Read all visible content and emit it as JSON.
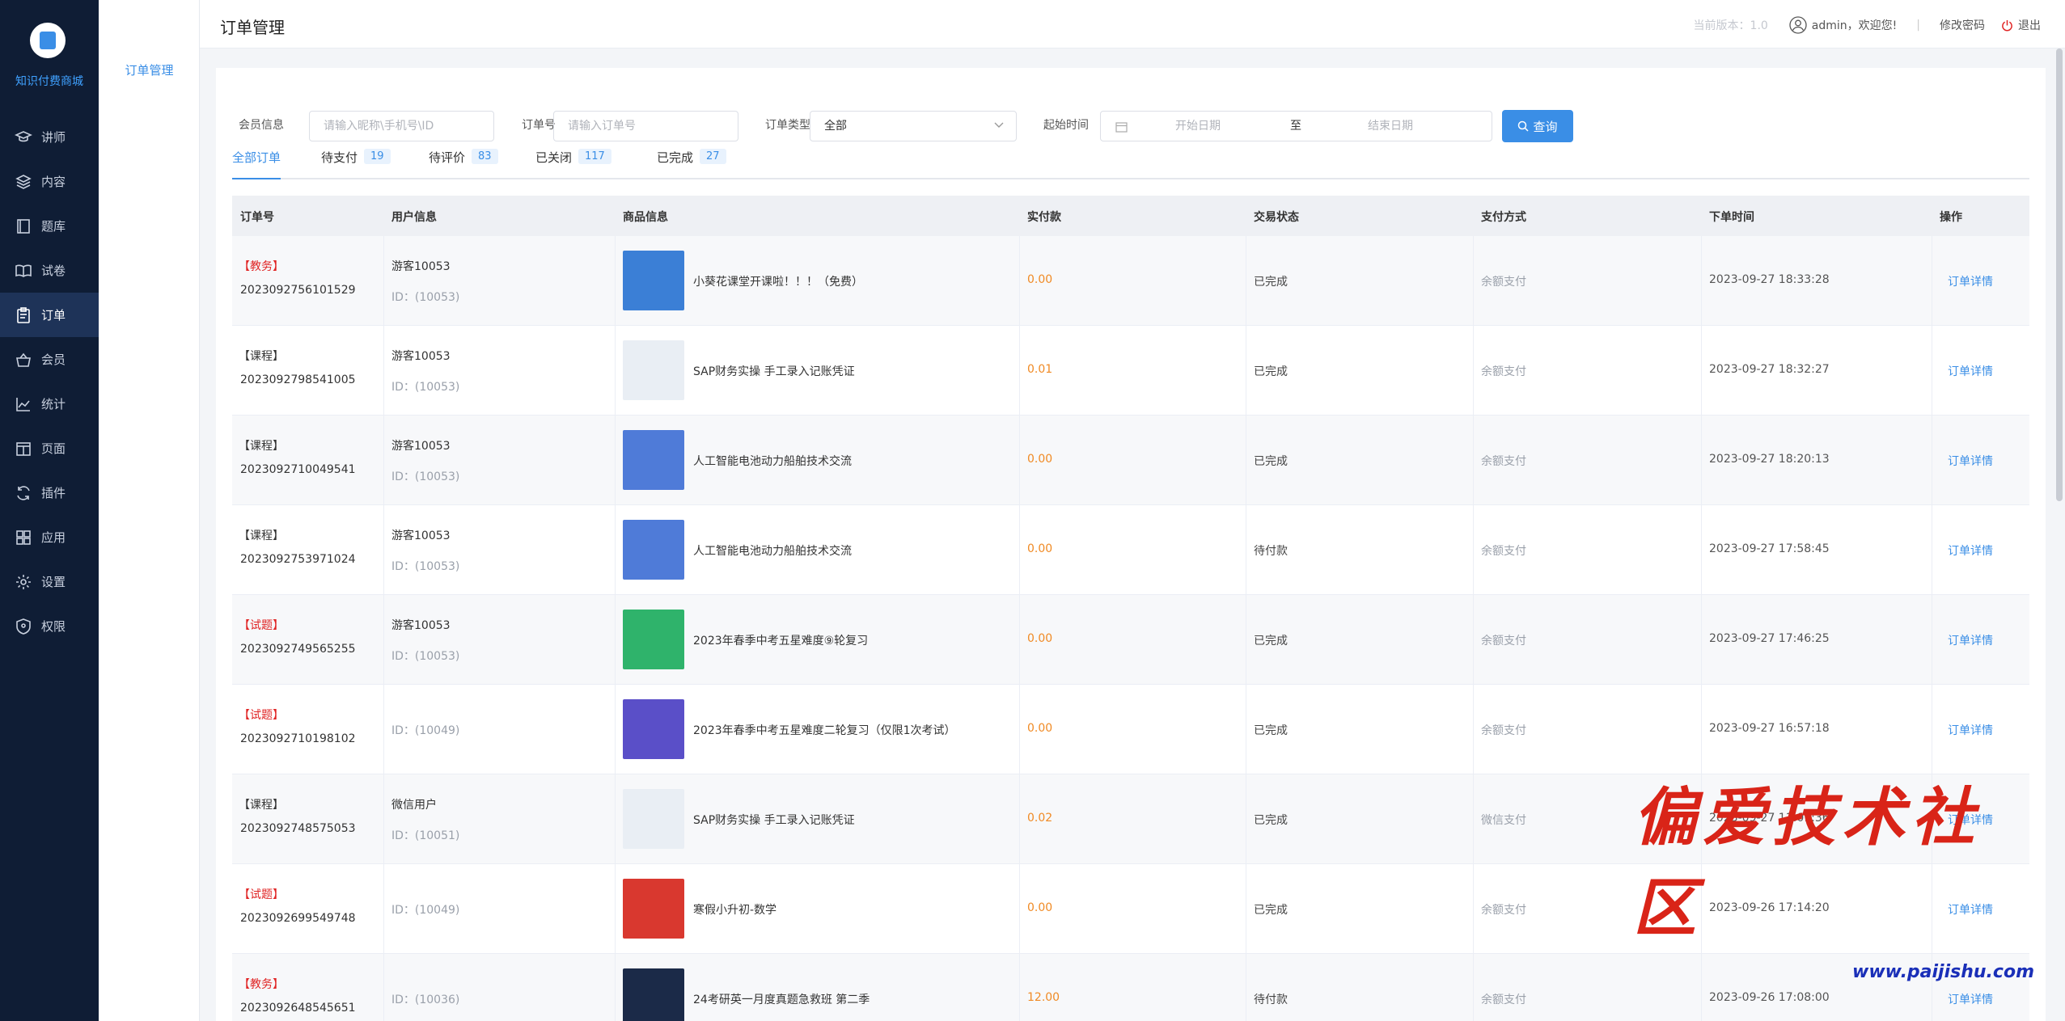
{
  "app": {
    "logo_text": "知识付费商城"
  },
  "sidebar": {
    "items": [
      {
        "label": "讲师",
        "icon": "graduation-cap-icon"
      },
      {
        "label": "内容",
        "icon": "layers-icon"
      },
      {
        "label": "题库",
        "icon": "book-icon"
      },
      {
        "label": "试卷",
        "icon": "open-book-icon"
      },
      {
        "label": "订单",
        "icon": "clipboard-icon",
        "active": true
      },
      {
        "label": "会员",
        "icon": "basket-icon"
      },
      {
        "label": "统计",
        "icon": "line-chart-icon"
      },
      {
        "label": "页面",
        "icon": "page-icon"
      },
      {
        "label": "插件",
        "icon": "refresh-icon"
      },
      {
        "label": "应用",
        "icon": "apps-icon"
      },
      {
        "label": "设置",
        "icon": "gear-icon"
      },
      {
        "label": "权限",
        "icon": "shield-icon"
      }
    ]
  },
  "submenu": {
    "item": "订单管理"
  },
  "header": {
    "title": "订单管理",
    "version": "当前版本：1.0",
    "welcome": "admin，欢迎您!",
    "separator": "|",
    "change_password": "修改密码",
    "logout": "退出"
  },
  "filters": {
    "member_label": "会员信息",
    "member_placeholder": "请输入昵称\\手机号\\ID",
    "order_no_label": "订单号",
    "order_no_placeholder": "请输入订单号",
    "order_type_label": "订单类型",
    "order_type_value": "全部",
    "time_label": "起始时间",
    "start_placeholder": "开始日期",
    "to_label": "至",
    "end_placeholder": "结束日期",
    "query_button": "查询"
  },
  "tabs": [
    {
      "label": "全部订单",
      "count": ""
    },
    {
      "label": "待支付",
      "count": "19"
    },
    {
      "label": "待评价",
      "count": "83"
    },
    {
      "label": "已关闭",
      "count": "117"
    },
    {
      "label": "已完成",
      "count": "27"
    }
  ],
  "table": {
    "headers": [
      "订单号",
      "用户信息",
      "商品信息",
      "实付款",
      "交易状态",
      "支付方式",
      "下单时间",
      "操作"
    ],
    "rows": [
      {
        "tag": "【教务】",
        "tag_red": true,
        "order_no": "2023092756101529",
        "user": "游客10053",
        "uid": "ID：(10053)",
        "product": "小葵花课堂开课啦！！！（免费）",
        "thumb": "#3b7fd6",
        "price": "0.00",
        "status": "已完成",
        "pay": "余额支付",
        "time": "2023-09-27 18:33:28",
        "action": "订单详情"
      },
      {
        "tag": "【课程】",
        "tag_red": false,
        "order_no": "2023092798541005",
        "user": "游客10053",
        "uid": "ID：(10053)",
        "product": "SAP财务实操 手工录入记账凭证",
        "thumb": "#e9eef4",
        "price": "0.01",
        "status": "已完成",
        "pay": "余额支付",
        "time": "2023-09-27 18:32:27",
        "action": "订单详情"
      },
      {
        "tag": "【课程】",
        "tag_red": false,
        "order_no": "2023092710049541",
        "user": "游客10053",
        "uid": "ID：(10053)",
        "product": "人工智能电池动力船舶技术交流",
        "thumb": "#4f7bd8",
        "price": "0.00",
        "status": "已完成",
        "pay": "余额支付",
        "time": "2023-09-27 18:20:13",
        "action": "订单详情"
      },
      {
        "tag": "【课程】",
        "tag_red": false,
        "order_no": "2023092753971024",
        "user": "游客10053",
        "uid": "ID：(10053)",
        "product": "人工智能电池动力船舶技术交流",
        "thumb": "#4f7bd8",
        "price": "0.00",
        "status": "待付款",
        "pay": "余额支付",
        "time": "2023-09-27 17:58:45",
        "action": "订单详情"
      },
      {
        "tag": "【试题】",
        "tag_red": true,
        "order_no": "2023092749565255",
        "user": "游客10053",
        "uid": "ID：(10053)",
        "product": "2023年春季中考五星难度⑨轮复习",
        "thumb": "#2fb36b",
        "price": "0.00",
        "status": "已完成",
        "pay": "余额支付",
        "time": "2023-09-27 17:46:25",
        "action": "订单详情"
      },
      {
        "tag": "【试题】",
        "tag_red": true,
        "order_no": "2023092710198102",
        "user": "",
        "uid": "ID：(10049)",
        "product": "2023年春季中考五星难度二轮复习（仅限1次考试）",
        "thumb": "#5a4fc8",
        "price": "0.00",
        "status": "已完成",
        "pay": "余额支付",
        "time": "2023-09-27 16:57:18",
        "action": "订单详情"
      },
      {
        "tag": "【课程】",
        "tag_red": false,
        "order_no": "2023092748575053",
        "user": "微信用户",
        "uid": "ID：(10051)",
        "product": "SAP财务实操 手工录入记账凭证",
        "thumb": "#e9eef4",
        "price": "0.02",
        "status": "已完成",
        "pay": "微信支付",
        "time": "2023-09-27 11:01:36",
        "action": "订单详情"
      },
      {
        "tag": "【试题】",
        "tag_red": true,
        "order_no": "2023092699549748",
        "user": "",
        "uid": "ID：(10049)",
        "product": "寒假小升初-数学",
        "thumb": "#d9382f",
        "price": "0.00",
        "status": "已完成",
        "pay": "余额支付",
        "time": "2023-09-26 17:14:20",
        "action": "订单详情"
      },
      {
        "tag": "【教务】",
        "tag_red": true,
        "order_no": "2023092648545651",
        "user": "",
        "uid": "ID：(10036)",
        "product": "24考研英一月度真题急救班 第二季",
        "thumb": "#1b2a48",
        "price": "12.00",
        "status": "待付款",
        "pay": "余额支付",
        "time": "2023-09-26 17:08:00",
        "action": "订单详情"
      }
    ]
  },
  "watermark": {
    "text": "偏爱技术社区",
    "url": "www.paijishu.com"
  }
}
